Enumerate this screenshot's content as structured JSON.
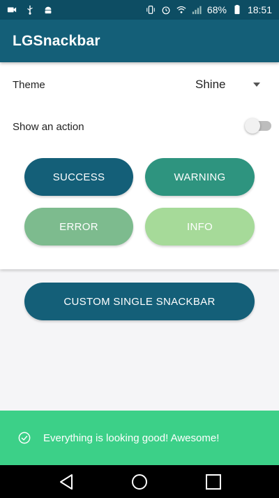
{
  "status_bar": {
    "battery_percent": "68%",
    "time": "18:51",
    "left_icons": [
      "video-camera-icon",
      "usb-icon",
      "android-icon"
    ],
    "right_icons": [
      "vibrate-icon",
      "alarm-icon",
      "wifi-icon",
      "signal-icon",
      "battery-icon"
    ]
  },
  "app_bar": {
    "title": "LGSnackbar"
  },
  "settings": {
    "theme_label": "Theme",
    "theme_value": "Shine",
    "action_label": "Show an action",
    "action_enabled": false
  },
  "buttons": {
    "success": "SUCCESS",
    "warning": "WARNING",
    "error": "ERROR",
    "info": "INFO",
    "custom": "CUSTOM SINGLE SNACKBAR"
  },
  "snackbar": {
    "icon": "check-circle-icon",
    "message": "Everything is looking good! Awesome!"
  },
  "colors": {
    "app_bar": "#145f78",
    "success": "#145f78",
    "warning": "#2e947f",
    "error": "#7dbb8e",
    "info": "#a6da99",
    "snackbar": "#3cd088"
  },
  "nav_bar": {
    "icons": [
      "back-icon",
      "home-icon",
      "recents-icon"
    ]
  }
}
